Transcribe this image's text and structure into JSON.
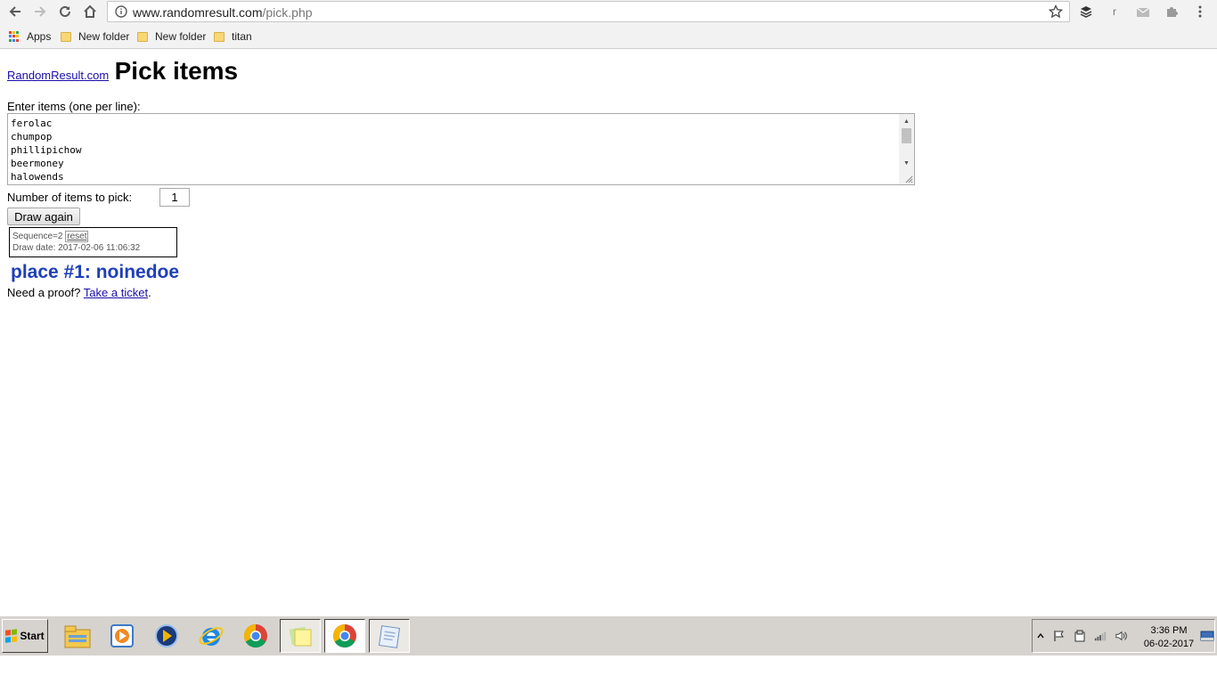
{
  "browser": {
    "url_host": "www.randomresult.com",
    "url_path": "/pick.php",
    "extension_letter": "r",
    "bookmarks": [
      {
        "label": "Apps",
        "icon": "apps-icon"
      },
      {
        "label": "New folder",
        "icon": "folder-icon"
      },
      {
        "label": "New folder",
        "icon": "folder-icon"
      },
      {
        "label": "titan",
        "icon": "folder-icon"
      }
    ]
  },
  "page": {
    "site_link": "RandomResult.com",
    "title": "Pick items",
    "items_label": "Enter items (one per line):",
    "items": [
      "ferolac",
      "chumpop",
      "phillipichow",
      "beermoney",
      "halowends"
    ],
    "count_label": "Number of items to pick:",
    "count_value": "1",
    "draw_button": "Draw again",
    "sequence_text": "Sequence=2",
    "reset_label": "reset",
    "draw_date": "Draw date: 2017-02-06 11:06:32",
    "result": "place #1: noinedoe",
    "proof_prefix": "Need a proof?",
    "proof_link": "Take a ticket",
    "proof_suffix": "."
  },
  "taskbar": {
    "start_label": "Start",
    "apps": [
      {
        "name": "file-explorer-icon"
      },
      {
        "name": "media-player-icon"
      },
      {
        "name": "media-center-icon"
      },
      {
        "name": "internet-explorer-icon"
      },
      {
        "name": "chrome-icon"
      },
      {
        "name": "sticky-notes-icon"
      },
      {
        "name": "chrome-active-icon"
      },
      {
        "name": "notepad-icon"
      }
    ],
    "time": "3:36 PM",
    "date": "06-02-2017"
  },
  "colors": {
    "link": "#1a0dab",
    "result": "#1f3fb8",
    "chrome_bg": "#f2f2f2",
    "taskbar_bg": "#d6d3ce"
  }
}
